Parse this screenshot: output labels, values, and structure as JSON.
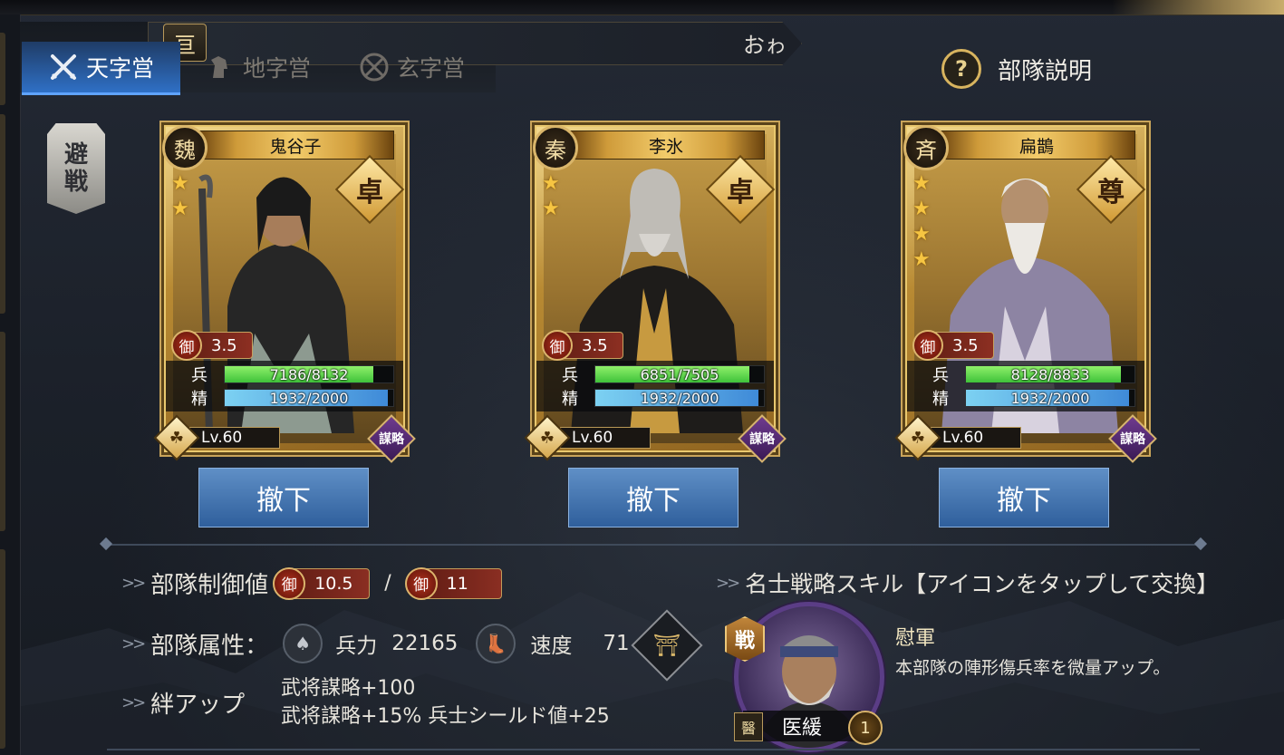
{
  "tabs": [
    {
      "label": "天字営",
      "icon": "crossed-swords-icon",
      "active": true
    },
    {
      "label": "地字営",
      "icon": "horse-icon",
      "active": false
    },
    {
      "label": "玄字営",
      "icon": "shield-icon",
      "active": false
    }
  ],
  "banner": {
    "icon_glyph": "亘",
    "label": "おゎ"
  },
  "help": {
    "icon_glyph": "?",
    "label": "部隊説明"
  },
  "avoid_battle": {
    "line1": "避",
    "line2": "戦"
  },
  "cards": [
    {
      "faction": "魏",
      "name": "鬼谷子",
      "stars": 2,
      "rank": "卓",
      "cost": "3.5",
      "troops_label": "兵",
      "troops": "7186/8132",
      "troops_ratio": 0.8837,
      "spirit_label": "精",
      "spirit": "1932/2000",
      "spirit_ratio": 0.966,
      "level": "Lv.60",
      "lv_glyph": "☘",
      "type_badge": "謀略",
      "button": "撤下"
    },
    {
      "faction": "秦",
      "name": "李氷",
      "stars": 2,
      "rank": "卓",
      "cost": "3.5",
      "troops_label": "兵",
      "troops": "6851/7505",
      "troops_ratio": 0.9129,
      "spirit_label": "精",
      "spirit": "1932/2000",
      "spirit_ratio": 0.966,
      "level": "Lv.60",
      "lv_glyph": "☘",
      "type_badge": "謀略",
      "button": "撤下"
    },
    {
      "faction": "斉",
      "name": "扁鵲",
      "stars": 4,
      "rank": "尊",
      "cost": "3.5",
      "troops_label": "兵",
      "troops": "8128/8833",
      "troops_ratio": 0.9202,
      "spirit_label": "精",
      "spirit": "1932/2000",
      "spirit_ratio": 0.966,
      "level": "Lv.60",
      "lv_glyph": "☘",
      "type_badge": "謀略",
      "button": "撤下"
    }
  ],
  "cost_glyph": "御",
  "control": {
    "label": "部隊制御値",
    "current": "10.5",
    "sep": "/",
    "max": "11"
  },
  "attributes": {
    "label": "部隊属性：",
    "power_label": "兵力",
    "power": "22165",
    "speed_label": "速度",
    "speed": "71",
    "formation_glyph": "⛩"
  },
  "bond": {
    "label": "絆アップ",
    "line1": "武将謀略+100",
    "line2": "武将謀略+15%  兵士シールド値+25"
  },
  "skill": {
    "header": "名士戦略スキル【アイコンをタップして交換】",
    "badge": "戦",
    "advisor_name": "医緩",
    "advisor_icon": "醫",
    "advisor_count": "1",
    "name": "慰軍",
    "description": "本部隊の陣形傷兵率を微量アップ。"
  }
}
